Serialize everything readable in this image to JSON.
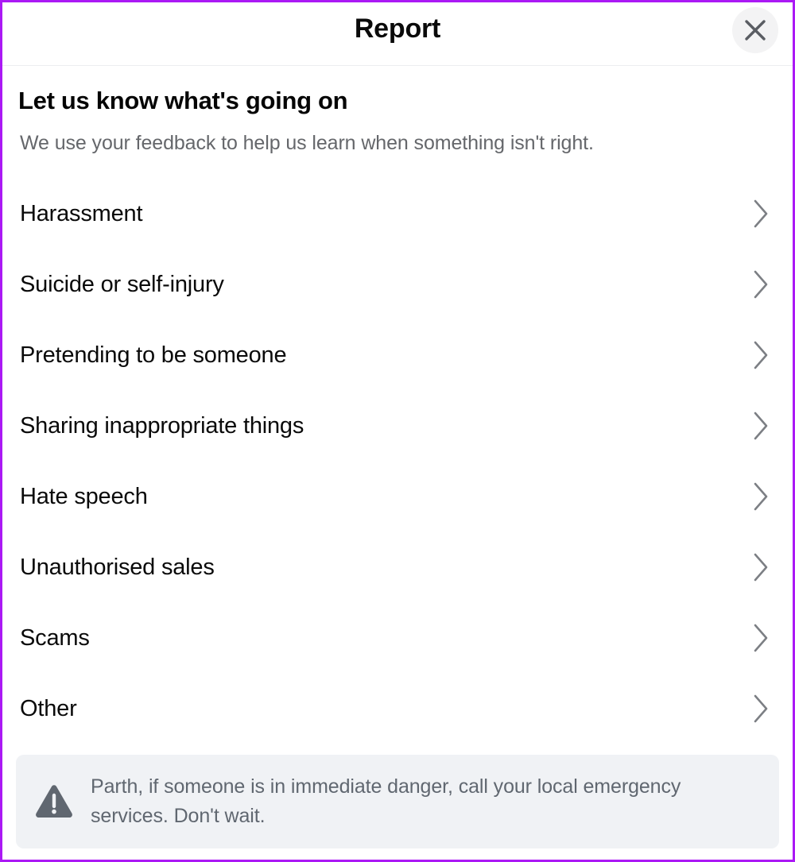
{
  "window": {
    "title": "Report",
    "close_icon": "close-icon",
    "accent_border_color": "#ab19f5"
  },
  "intro": {
    "heading": "Let us know what's going on",
    "subtext": "We use your feedback to help us learn when something isn't right."
  },
  "reasons": [
    {
      "label": "Harassment",
      "chevron": "chevron-right-icon"
    },
    {
      "label": "Suicide or self-injury",
      "chevron": "chevron-right-icon"
    },
    {
      "label": "Pretending to be someone",
      "chevron": "chevron-right-icon"
    },
    {
      "label": "Sharing inappropriate things",
      "chevron": "chevron-right-icon"
    },
    {
      "label": "Hate speech",
      "chevron": "chevron-right-icon"
    },
    {
      "label": "Unauthorised sales",
      "chevron": "chevron-right-icon"
    },
    {
      "label": "Scams",
      "chevron": "chevron-right-icon"
    },
    {
      "label": "Other",
      "chevron": "chevron-right-icon"
    }
  ],
  "warning": {
    "icon": "warning-triangle-icon",
    "text": "Parth, if someone is in immediate danger, call your local emergency services. Don't wait."
  }
}
